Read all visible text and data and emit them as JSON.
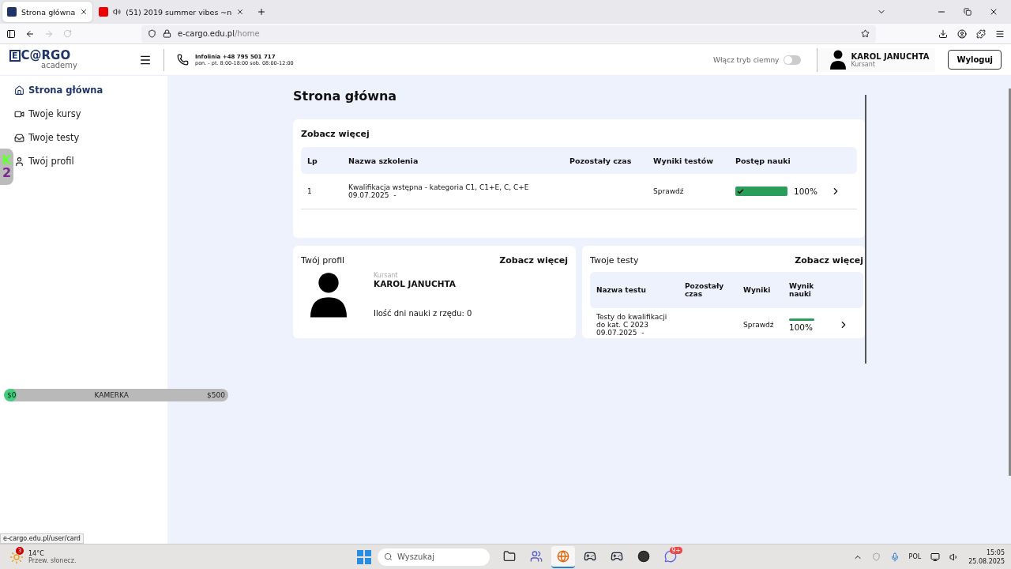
{
  "browser": {
    "tabs": [
      {
        "title": "Strona główna",
        "selected": true,
        "kind": "site"
      },
      {
        "title": "(51) 2019 summer vibes ~n",
        "selected": false,
        "kind": "media"
      }
    ],
    "address": {
      "host": "e-cargo.edu.pl",
      "path": "/home"
    }
  },
  "header": {
    "logo": {
      "mark": "E",
      "main": "C@RGO",
      "sub": "academy"
    },
    "hotline": {
      "title": "Infolinia +48 795 501 717",
      "hours": "pon. - pt. 8:00-18:00 sob. 08:00-12:00"
    },
    "dark_mode": {
      "label": "Włącz tryb ciemny",
      "on": false
    },
    "user": {
      "name": "KAROL JANUCHTA",
      "role": "Kursant"
    },
    "logout": "Wyloguj"
  },
  "sidebar": {
    "items": [
      {
        "label": "Strona główna",
        "selected": true,
        "kind": "home"
      },
      {
        "label": "Twoje kursy",
        "selected": false,
        "kind": "video"
      },
      {
        "label": "Twoje testy",
        "selected": false,
        "kind": "inbox"
      },
      {
        "label": "Twój profil",
        "selected": false,
        "kind": "user"
      }
    ]
  },
  "overlay": {
    "badge": {
      "letter": "K",
      "number": "2"
    },
    "camera_bar": {
      "start": "$0",
      "label": "KAMERKA",
      "end": "$500",
      "level": 0.04
    }
  },
  "page_title": "Strona główna",
  "courses": {
    "title": "Zobacz więcej",
    "columns": [
      "Lp",
      "Nazwa szkolenia",
      "Pozostały czas",
      "Wyniki testów",
      "Postęp nauki"
    ],
    "rows": [
      {
        "lp": "1",
        "name": "Kwalifikacja wstępna - kategoria C1, C1+E, C, C+E",
        "date": "09.07.2025  -",
        "results": "Sprawdź",
        "level": 1,
        "percent": "100%"
      }
    ]
  },
  "profile": {
    "title": "Twój profil",
    "link": "Zobacz więcej",
    "role": "Kursant",
    "name": "KAROL JANUCHTA",
    "streak": "Ilość dni nauki z rzędu: 0"
  },
  "tests": {
    "title": "Twoje testy",
    "link": "Zobacz więcej",
    "columns": [
      "Nazwa testu",
      "Pozostały czas",
      "Wyniki",
      "Wynik nauki"
    ],
    "rows": [
      {
        "name": "Testy do kwalifikacji do kat. C 2023",
        "date": "09.07.2025  -",
        "results": "Sprawdź",
        "level": 1,
        "percent": "100%"
      }
    ]
  },
  "status_url": "e-cargo.edu.pl/user/card",
  "taskbar": {
    "weather": {
      "badge": "3",
      "temp": "14°C",
      "desc": "Przew. słonecz."
    },
    "search": {
      "placeholder": "Wyszukaj"
    },
    "apps": [
      {
        "kind": "files",
        "active": false
      },
      {
        "kind": "teams",
        "active": false
      },
      {
        "kind": "browser",
        "active": true
      },
      {
        "kind": "steam",
        "active": false
      },
      {
        "kind": "steam",
        "active": false
      },
      {
        "kind": "recorder",
        "active": false
      },
      {
        "kind": "chat",
        "active": false,
        "badge": "9+"
      }
    ],
    "tray": {
      "lang": "POL",
      "time": "15:05",
      "date": "25.08.2025"
    }
  }
}
